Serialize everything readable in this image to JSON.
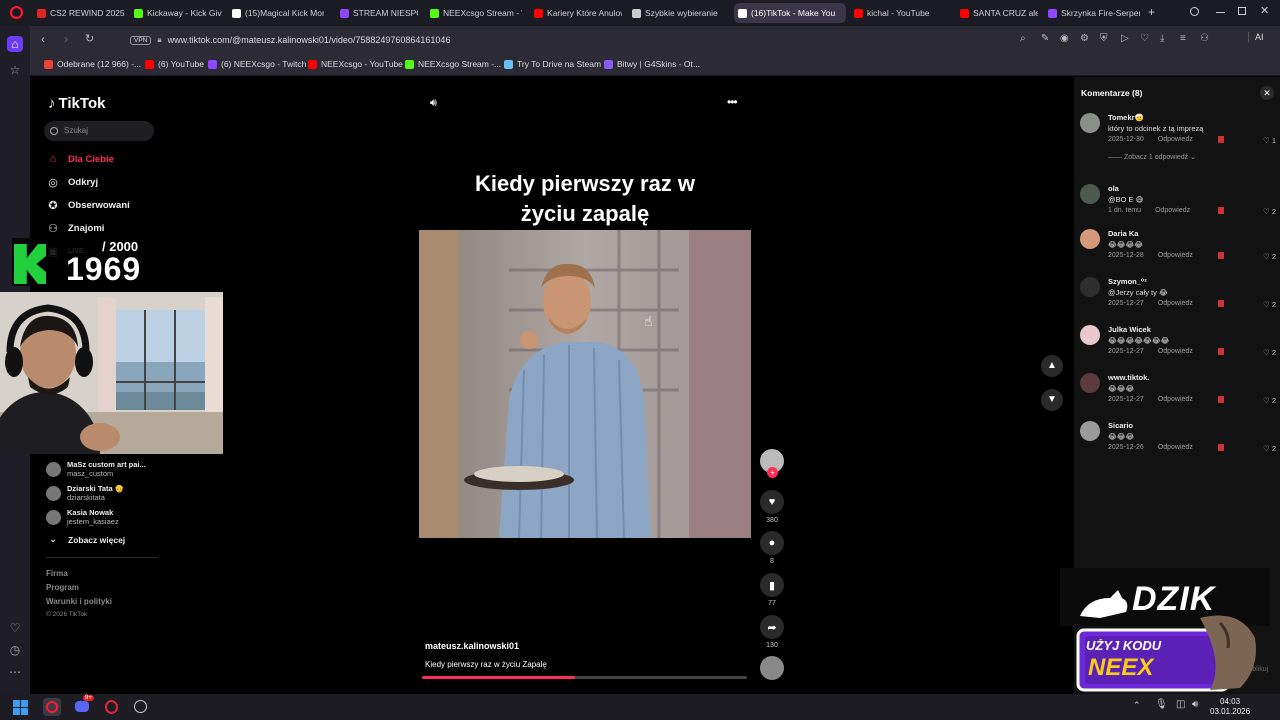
{
  "browser": {
    "tabs": [
      {
        "label": "CS2 REWIND 2025 -",
        "color": "#e02424"
      },
      {
        "label": "Kickaway - Kick Give",
        "color": "#53fc18"
      },
      {
        "label": "(15)Magical Kick Mon",
        "color": "#ffffff"
      },
      {
        "label": "STREAM NIESPO",
        "color": "#9146ff"
      },
      {
        "label": "NEEXcsgo Stream - W",
        "color": "#53fc18"
      },
      {
        "label": "Kariery Które Anulow",
        "color": "#ff0000"
      },
      {
        "label": "Szybkie wybieranie",
        "color": "#cccccc"
      },
      {
        "label": "(16)TikTok - Make You",
        "color": "#ffffff"
      },
      {
        "label": "kichal - YouTube",
        "color": "#ff0000"
      },
      {
        "label": "SANTA CRUZ ale to W",
        "color": "#ff0000"
      },
      {
        "label": "Skrzynka Fire-Serpent",
        "color": "#9146ff"
      }
    ],
    "new_tab": "+",
    "url": "www.tiktok.com/@mateusz.kalinowski01/video/7588249760864161046",
    "vpn": "VPN",
    "ai_label": "AI",
    "bookmarks": [
      {
        "label": "Odebrane (12 966) -...",
        "color": "#ea4335"
      },
      {
        "label": "(6) YouTube",
        "color": "#ff0000"
      },
      {
        "label": "(6) NEEXcsgo - Twitch",
        "color": "#9146ff"
      },
      {
        "label": "NEEXcsgo - YouTube",
        "color": "#ff0000"
      },
      {
        "label": "NEEXcsgo Stream -...",
        "color": "#53fc18"
      },
      {
        "label": "Try To Drive na Steam",
        "color": "#66c0f4"
      },
      {
        "label": "Bitwy | G4Skins - Ot...",
        "color": "#8a5cf6"
      }
    ]
  },
  "tiktok": {
    "logo": "TikTok",
    "search_placeholder": "Szukaj",
    "nav": [
      {
        "label": "Dla Ciebie",
        "icon": "home-icon"
      },
      {
        "label": "Odkryj",
        "icon": "compass-icon"
      },
      {
        "label": "Obserwowani",
        "icon": "following-icon"
      },
      {
        "label": "Znajomi",
        "icon": "friends-icon"
      },
      {
        "label": "LIVE",
        "icon": "live-icon"
      }
    ],
    "following": [
      {
        "name": "MaSz custom art pai...",
        "handle": "masz_custom"
      },
      {
        "name": "Dziarski Tata 👴",
        "handle": "dziarskitata"
      },
      {
        "name": "Kasia Nowak",
        "handle": "jestem_kasiaez"
      }
    ],
    "see_more": "Zobacz więcej",
    "footer": [
      "Firma",
      "Program",
      "Warunki i polityki",
      "© 2026 TikTok"
    ],
    "video": {
      "title_line1": "Kiedy pierwszy raz w",
      "title_line2": "życiu zapalę",
      "author": "mateusz.kalinowski01",
      "description": "Kiedy pierwszy raz w życiu Zapalę",
      "progress": 0.47
    },
    "actions": {
      "likes": "380",
      "comments": "8",
      "saves": "77",
      "shares": "130"
    },
    "comments_title": "Komentarze (8)",
    "reply_label": "Odpowiedz",
    "comments": [
      {
        "name": "Tomekr🤕",
        "text": "który to odcinek z tą imprezą",
        "date": "2025-12-30",
        "likes": "1",
        "more": "Zobacz 1 odpowiedź"
      },
      {
        "name": "ola",
        "text": "@BO E 😅",
        "date": "1 dn. temu",
        "likes": "2"
      },
      {
        "name": "Daria Ka",
        "text": "😂😂😂😂",
        "date": "2025-12-28",
        "likes": "2"
      },
      {
        "name": "Szymon_⁰²",
        "text": "@Jerzy cały ty 😂",
        "date": "2025-12-27",
        "likes": "2"
      },
      {
        "name": "Julka Wicek",
        "text": "😂😂😂😂😂😂😂",
        "date": "2025-12-27",
        "likes": "2"
      },
      {
        "name": "www.tiktok.",
        "text": "😂😂😂",
        "date": "2025-12-27",
        "likes": "2"
      },
      {
        "name": "Sicario",
        "text": "😂😂😂",
        "date": "2025-12-26",
        "likes": "2"
      }
    ],
    "publish": "Opublikuj"
  },
  "overlay": {
    "counter_goal": "/ 2000",
    "counter_value": "1969",
    "sponsor_brand": "DZIK",
    "sponsor_line1": "UŻYJ KODU",
    "sponsor_line2": "NEEX"
  },
  "taskbar": {
    "time": "04:03",
    "date": "03.01.2026",
    "discord_badge": "9+"
  }
}
